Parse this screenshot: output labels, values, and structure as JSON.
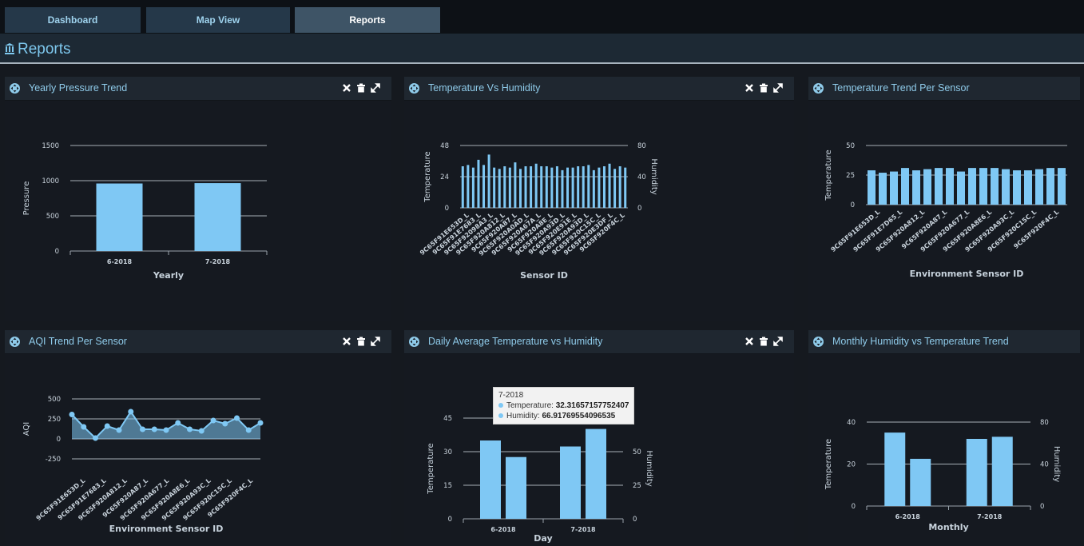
{
  "tabs": [
    {
      "label": "Dashboard",
      "active": false
    },
    {
      "label": "Map View",
      "active": false
    },
    {
      "label": "Reports",
      "active": true
    }
  ],
  "page": {
    "title": "Reports",
    "icon": "bank-icon"
  },
  "colors": {
    "bar": "#7fc8f4",
    "accent": "#7ec8ee",
    "panel": "#151920",
    "header": "#1f2730"
  },
  "panels": [
    {
      "title": "Yearly Pressure Trend",
      "controls": [
        "close-icon",
        "trash-icon",
        "expand-icon"
      ]
    },
    {
      "title": "Temperature Vs Humidity",
      "controls": [
        "close-icon",
        "trash-icon",
        "expand-icon"
      ]
    },
    {
      "title": "Temperature Trend Per Sensor",
      "controls": []
    },
    {
      "title": "AQI Trend Per Sensor",
      "controls": [
        "close-icon",
        "trash-icon",
        "expand-icon"
      ]
    },
    {
      "title": "Daily Average Temperature vs Humidity",
      "controls": [
        "close-icon",
        "trash-icon",
        "expand-icon"
      ]
    },
    {
      "title": "Monthly Humidity vs Temperature Trend",
      "controls": []
    }
  ],
  "tooltip": {
    "header": "7-2018",
    "rows": [
      {
        "label": "Temperature:",
        "value": "32.31657157752407"
      },
      {
        "label": "Humidity:",
        "value": "66.91769554096535"
      }
    ]
  },
  "chart_data": [
    {
      "type": "bar",
      "categories": [
        "6-2018",
        "7-2018"
      ],
      "values": [
        960,
        965
      ],
      "xlabel": "Yearly",
      "ylabel": "Pressure",
      "ylim": [
        0,
        1500
      ],
      "yticks": [
        0,
        500,
        1000,
        1500
      ],
      "grid": true
    },
    {
      "type": "bar",
      "categories": [
        "9C65F91E653D_L",
        "9C65F91E7683_L",
        "9C65F92098A3_L",
        "9C65F920A812_L",
        "9C65F920A87_L",
        "9C65F920A0AD_L",
        "9C65F920A67A_L",
        "9C65F920A8E_L",
        "9C65F920A93D_L",
        "9C65F920E91E_L",
        "9C65F920A93D_L",
        "9C65F920C15C_L",
        "9C65F920E3DF_L",
        "9C65F920F4C_L"
      ],
      "series": [
        {
          "name": "Temperature",
          "values": [
            32,
            33,
            31,
            37,
            33,
            41,
            31,
            30,
            32,
            31,
            35,
            30,
            32,
            32,
            34,
            32,
            32,
            31,
            32,
            29,
            31,
            31,
            32,
            32,
            33,
            29,
            31,
            32,
            34,
            30,
            32,
            31
          ]
        },
        {
          "name": "Humidity",
          "values": [
            58,
            62,
            60,
            64,
            61,
            66,
            60,
            58,
            62,
            59,
            65,
            58,
            60,
            61,
            63,
            60,
            62,
            58,
            60,
            56,
            61,
            60,
            62,
            63,
            61,
            58,
            61,
            62,
            64,
            60,
            61,
            60
          ]
        }
      ],
      "xlabel": "Sensor ID",
      "ylabel": "Temperature",
      "y2label": "Humidity",
      "ylim": [
        0,
        48
      ],
      "yticks": [
        0,
        24,
        48
      ],
      "y2lim": [
        0,
        80
      ],
      "y2ticks": [
        0,
        40,
        80
      ],
      "grid": true
    },
    {
      "type": "bar",
      "categories": [
        "9C65F91E653D_L",
        "9C65F91E7D65_L",
        "9C65F920A812_L",
        "9C65F920A87_L",
        "9C65F920A677_L",
        "9C65F920A8E6_L",
        "9C65F920A93C_L",
        "9C65F920C15C_L",
        "9C65F920F4C_L"
      ],
      "values": [
        29,
        27,
        28,
        31,
        29,
        30,
        31,
        31,
        28,
        31,
        31,
        31,
        30,
        29,
        29,
        30,
        31,
        31
      ],
      "xlabel": "Environment Sensor ID",
      "ylabel": "Temperature",
      "ylim": [
        0,
        50
      ],
      "yticks": [
        0,
        25,
        50
      ],
      "grid": true
    },
    {
      "type": "area",
      "categories": [
        "9C65F91E653D_L",
        "9C65F91E7683_L",
        "9C65F920A812_L",
        "9C65F920A87_L",
        "9C65F920A677_L",
        "9C65F920A8E6_L",
        "9C65F920A93C_L",
        "9C65F920C15C_L",
        "9C65F920F4C_L"
      ],
      "values": [
        305,
        150,
        10,
        160,
        110,
        340,
        120,
        120,
        110,
        200,
        120,
        100,
        230,
        190,
        260,
        110,
        200
      ],
      "xlabel": "Environment Sensor ID",
      "ylabel": "AQI",
      "ylim": [
        -250,
        500
      ],
      "yticks": [
        -250,
        0,
        250,
        500
      ],
      "grid": true
    },
    {
      "type": "bar",
      "categories": [
        "6-2018",
        "7-2018"
      ],
      "series": [
        {
          "name": "Temperature",
          "values": [
            35,
            32.31657157752407
          ]
        },
        {
          "name": "Humidity",
          "values": [
            46,
            66.91769554096535
          ]
        }
      ],
      "xlabel": "Day",
      "ylabel": "Temperature",
      "y2label": "Humidity",
      "ylim": [
        0,
        45
      ],
      "yticks": [
        0,
        15,
        30,
        45
      ],
      "y2lim": [
        0,
        75
      ],
      "y2ticks": [
        0,
        25,
        50
      ],
      "grid": true
    },
    {
      "type": "bar",
      "categories": [
        "6-2018",
        "7-2018"
      ],
      "series": [
        {
          "name": "Temperature",
          "values": [
            35,
            32
          ]
        },
        {
          "name": "Humidity",
          "values": [
            45,
            66
          ]
        }
      ],
      "xlabel": "Monthly",
      "ylabel": "Temperature",
      "y2label": "Humidity",
      "ylim": [
        0,
        40
      ],
      "yticks": [
        0,
        20,
        40
      ],
      "y2lim": [
        0,
        80
      ],
      "y2ticks": [
        0,
        40,
        80
      ],
      "grid": true
    }
  ]
}
